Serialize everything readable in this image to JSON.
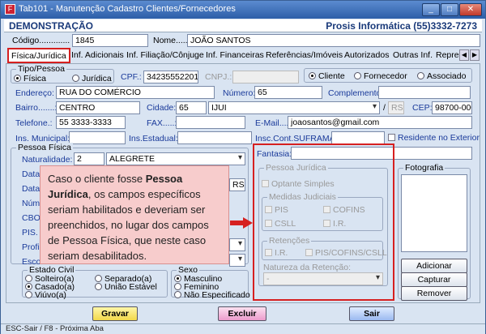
{
  "window": {
    "title": "Tab101 - Manutenção Cadastro Clientes/Fornecedores",
    "app_icon": "F",
    "minimize": "_",
    "maximize": "□",
    "close": "✕"
  },
  "header": {
    "left": "DEMONSTRAÇÃO",
    "right": "Prosis Informática (55)3332-7273"
  },
  "top": {
    "codigo_label": "Código.............",
    "codigo": "1845",
    "nome_label": "Nome.....:",
    "nome": "JOÃO SANTOS"
  },
  "tabs": [
    "Física/Jurídica",
    "Inf. Adicionais",
    "Inf. Filiação/Cônjuge",
    "Inf. Financeiras",
    "Referências/Imóveis",
    "Autorizados",
    "Outras Inf.",
    "Repre"
  ],
  "tab_arrows": {
    "left": "◀",
    "right": "▶"
  },
  "tipo_pessoa": {
    "title": "Tipo/Pessoa",
    "fisica": "Física",
    "juridica": "Jurídica"
  },
  "cpf": {
    "label": "CPF.:",
    "value": "34235552201"
  },
  "cnpj": {
    "label": "CNPJ.:",
    "value": ""
  },
  "tipo_cad": {
    "cliente": "Cliente",
    "fornecedor": "Fornecedor",
    "associado": "Associado"
  },
  "endereco": {
    "label": "Endereço:",
    "value": "RUA DO COMÉRCIO",
    "numero_label": "Número:",
    "numero": "65",
    "compl_label": "Complemento:",
    "compl": ""
  },
  "bairro": {
    "label": "Bairro.......:",
    "value": "CENTRO",
    "cidade_label": "Cidade:",
    "cidade_cod": "65",
    "cidade": "IJUI",
    "slash": "/",
    "uf": "RS",
    "cep_label": "CEP:",
    "cep": "98700-000"
  },
  "telefone": {
    "label": "Telefone.:",
    "value": "55 3333-3333",
    "fax_label": "FAX.....:",
    "fax": "",
    "email_label": "E-Mail....:",
    "email": "joaosantos@gmail.com"
  },
  "ins": {
    "municipal_label": "Ins. Municipal:",
    "municipal": "",
    "estadual_label": "Ins.Estadual:",
    "estadual": "",
    "suframa_label": "Insc.Cont.SUFRAMA:",
    "suframa": "",
    "residente": "Residente no Exterior"
  },
  "pessoa_fisica": {
    "title": "Pessoa Física",
    "nat_label": "Naturalidade:",
    "nat_cod": "2",
    "nat": "ALEGRETE",
    "data1": "Data",
    "data2": "Data",
    "num": "Núm",
    "cbo": "CBO.",
    "pis": "PIS.",
    "prof": "Profis",
    "esc": "Escol",
    "rs": "RS"
  },
  "estado_civil": {
    "title": "Estado Civil",
    "solteiro": "Solteiro(a)",
    "casado": "Casado(a)",
    "viuvo": "Viúvo(a)",
    "separado": "Separado(a)",
    "uniao": "União Estável"
  },
  "sexo": {
    "title": "Sexo",
    "masc": "Masculino",
    "fem": "Feminino",
    "nao": "Não Especificado"
  },
  "fantasia": {
    "label": "Fantasia:",
    "value": ""
  },
  "pessoa_juridica": {
    "title": "Pessoa Jurídica",
    "optante": "Optante Simples",
    "medidas": "Medidas Judiciais",
    "pis": "PIS",
    "cofins": "COFINS",
    "csll": "CSLL",
    "ir": "I.R.",
    "retencoes": "Retenções",
    "ret_ir": "I.R.",
    "ret_pis": "PIS/COFINS/CSLL",
    "natureza": "Natureza da Retenção:",
    "natureza_val": "-"
  },
  "fotografia": {
    "title": "Fotografia",
    "adicionar": "Adicionar",
    "capturar": "Capturar",
    "remover": "Remover"
  },
  "note": {
    "text_a": "Caso o cliente fosse ",
    "text_b": "Pessoa Jurídica",
    "text_c": ", os campos específicos seriam habilitados e deveriam ser preenchidos, no lugar dos campos de Pessoa Física, que neste caso seriam desabilitados."
  },
  "buttons": {
    "gravar": "Gravar",
    "excluir": "Excluir",
    "sair": "Sair"
  },
  "status": "ESC-Sair / F8 - Próxima Aba"
}
